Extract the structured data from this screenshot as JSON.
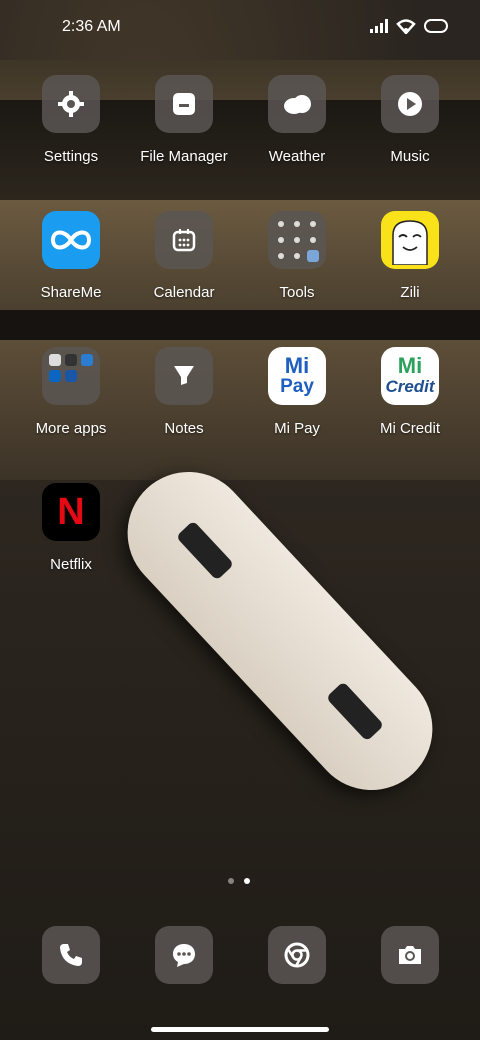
{
  "status_bar": {
    "time": "2:36 AM"
  },
  "apps": [
    {
      "label": "Settings",
      "icon": "settings-icon"
    },
    {
      "label": "File Manager",
      "icon": "folder-icon"
    },
    {
      "label": "Weather",
      "icon": "cloud-icon"
    },
    {
      "label": "Music",
      "icon": "play-icon"
    },
    {
      "label": "ShareMe",
      "icon": "infinity-icon"
    },
    {
      "label": "Calendar",
      "icon": "calendar-icon"
    },
    {
      "label": "Tools",
      "icon": "tools-folder-icon"
    },
    {
      "label": "Zili",
      "icon": "zili-face-icon"
    },
    {
      "label": "More apps",
      "icon": "apps-folder-icon"
    },
    {
      "label": "Notes",
      "icon": "notes-icon"
    },
    {
      "label": "Mi Pay",
      "icon": "mipay-icon",
      "badge_text": "Mi",
      "sub_text": "Pay"
    },
    {
      "label": "Mi Credit",
      "icon": "micredit-icon",
      "badge_text": "Mi",
      "sub_text": "Credit"
    },
    {
      "label": "Netflix",
      "icon": "netflix-icon",
      "badge_text": "N"
    }
  ],
  "dock": [
    {
      "name": "phone",
      "icon": "phone-icon"
    },
    {
      "name": "messages",
      "icon": "message-icon"
    },
    {
      "name": "chrome",
      "icon": "chrome-icon"
    },
    {
      "name": "camera",
      "icon": "camera-icon"
    }
  ],
  "page_indicator": {
    "pages": 2,
    "current": 2
  },
  "colors": {
    "mi_green": "#2ba15b",
    "mi_blue": "#1f5fbf",
    "netflix_red": "#e50914",
    "shareme_blue": "#1a9cf0",
    "zili_yellow": "#f9e21a"
  }
}
